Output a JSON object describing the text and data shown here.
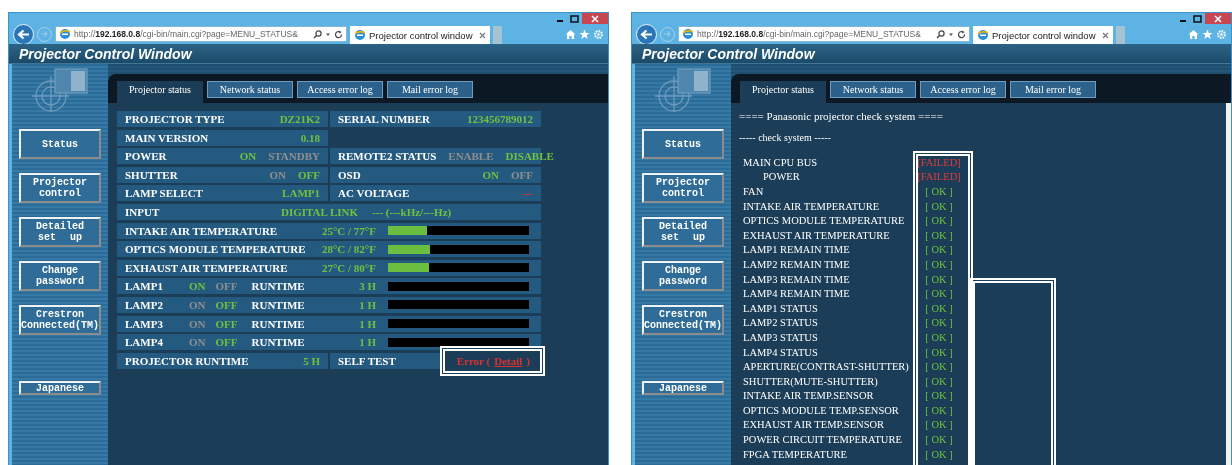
{
  "windows": [
    {
      "address": "http://**192.168.0.8**/cgi-bin/main.cgi?page=MENU_STATUS&",
      "tab_title": "Projector control window",
      "app_title": "Projector Control Window",
      "scrollbar": false,
      "sidebar": {
        "items": [
          "Status",
          "Projector control",
          "Detailed set up",
          "Change password",
          "Crestron Connected(TM)"
        ],
        "language": "Japanese"
      },
      "tabs": [
        {
          "label": "Projector status",
          "selected": true
        },
        {
          "label": "Network status",
          "selected": false
        },
        {
          "label": "Access error log",
          "selected": false
        },
        {
          "label": "Mail error log",
          "selected": false
        }
      ],
      "content": {
        "kind": "status",
        "rows": [
          {
            "kind": "pair",
            "cells": [
              {
                "label": "PROJECTOR TYPE",
                "value": "DZ21K2",
                "alert": false
              },
              {
                "label": "SERIAL NUMBER",
                "value": "123456789012",
                "alert": false
              }
            ]
          },
          {
            "kind": "pair",
            "cells": [
              {
                "label": "MAIN VERSION",
                "value": "0.18",
                "alert": false
              }
            ]
          },
          {
            "kind": "pair",
            "cells": [
              {
                "label": "POWER",
                "options": [
                  {
                    "text": "ON",
                    "on": true
                  },
                  {
                    "text": "STANDBY",
                    "on": false
                  }
                ]
              },
              {
                "label": "REMOTE2 STATUS",
                "options": [
                  {
                    "text": "ENABLE",
                    "on": false
                  },
                  {
                    "text": "DISABLE",
                    "on": true
                  }
                ]
              }
            ]
          },
          {
            "kind": "pair",
            "cells": [
              {
                "label": "SHUTTER",
                "options": [
                  {
                    "text": "ON",
                    "on": false
                  },
                  {
                    "text": "OFF",
                    "on": true
                  }
                ]
              },
              {
                "label": "OSD",
                "options": [
                  {
                    "text": "ON",
                    "on": true
                  },
                  {
                    "text": "OFF",
                    "on": false
                  }
                ]
              }
            ]
          },
          {
            "kind": "pair",
            "cells": [
              {
                "label": "LAMP SELECT",
                "value": "LAMP1",
                "alert": false
              },
              {
                "label": "AC VOLTAGE",
                "value": "---",
                "alert": true
              }
            ]
          },
          {
            "kind": "input",
            "label": "INPUT",
            "value": "DIGITAL LINK",
            "detail": "--- (---kHz/---Hz)"
          },
          {
            "kind": "meter",
            "label": "INTAKE AIR TEMPERATURE",
            "reading": "25°C / 77°F",
            "level": 0.28
          },
          {
            "kind": "meter",
            "label": "OPTICS MODULE TEMPERATURE",
            "reading": "28°C / 82°F",
            "level": 0.3
          },
          {
            "kind": "meter",
            "label": "EXHAUST AIR TEMPERATURE",
            "reading": "27°C / 80°F",
            "level": 0.29
          },
          {
            "kind": "lamp",
            "label": "LAMP1",
            "options": [
              {
                "text": "ON",
                "on": true
              },
              {
                "text": "OFF",
                "on": false
              }
            ],
            "runtime_label": "RUNTIME",
            "runtime": "3 H",
            "level": 0
          },
          {
            "kind": "lamp",
            "label": "LAMP2",
            "options": [
              {
                "text": "ON",
                "on": false
              },
              {
                "text": "OFF",
                "on": true
              }
            ],
            "runtime_label": "RUNTIME",
            "runtime": "1 H",
            "level": 0
          },
          {
            "kind": "lamp",
            "label": "LAMP3",
            "options": [
              {
                "text": "ON",
                "on": false
              },
              {
                "text": "OFF",
                "on": true
              }
            ],
            "runtime_label": "RUNTIME",
            "runtime": "1 H",
            "level": 0
          },
          {
            "kind": "lamp",
            "label": "LAMP4",
            "options": [
              {
                "text": "ON",
                "on": false
              },
              {
                "text": "OFF",
                "on": true
              }
            ],
            "runtime_label": "RUNTIME",
            "runtime": "1 H",
            "level": 0
          },
          {
            "kind": "pair",
            "cells": [
              {
                "label": "PROJECTOR RUNTIME",
                "value": "5 H",
                "alert": false
              },
              {
                "label": "SELF TEST",
                "result": "Error (",
                "link": "Detail",
                "result_end": ")",
                "highlighted": true
              }
            ]
          }
        ]
      }
    },
    {
      "address": "http://**192.168.0.8**/cgi-bin/main.cgi?page=MENU_STATUS&",
      "tab_title": "Projector control window",
      "app_title": "Projector Control Window",
      "scrollbar": true,
      "sidebar": {
        "items": [
          "Status",
          "Projector control",
          "Detailed set up",
          "Change password",
          "Crestron Connected(TM)"
        ],
        "language": "Japanese"
      },
      "tabs": [
        {
          "label": "Projector status",
          "selected": true
        },
        {
          "label": "Network status",
          "selected": false
        },
        {
          "label": "Access error log",
          "selected": false
        },
        {
          "label": "Mail error log",
          "selected": false
        }
      ],
      "content": {
        "kind": "check",
        "heading": "==== Panasonic projector check system ====",
        "subheading": "----- check system -----",
        "highlighted": true,
        "checks": [
          {
            "name": "MAIN CPU BUS",
            "result": "[FAILED]",
            "failed": true,
            "children": [
              {
                "name": "POWER",
                "result": "[FAILED]",
                "failed": true
              }
            ]
          },
          {
            "name": "FAN",
            "result": "[ OK ]",
            "failed": false
          },
          {
            "name": "INTAKE AIR TEMPERATURE",
            "result": "[ OK ]",
            "failed": false
          },
          {
            "name": "OPTICS MODULE TEMPERATURE",
            "result": "[ OK ]",
            "failed": false
          },
          {
            "name": "EXHAUST AIR TEMPERATURE",
            "result": "[ OK ]",
            "failed": false
          },
          {
            "name": "LAMP1 REMAIN TIME",
            "result": "[ OK ]",
            "failed": false
          },
          {
            "name": "LAMP2 REMAIN TIME",
            "result": "[ OK ]",
            "failed": false
          },
          {
            "name": "LAMP3 REMAIN TIME",
            "result": "[ OK ]",
            "failed": false
          },
          {
            "name": "LAMP4 REMAIN TIME",
            "result": "[ OK ]",
            "failed": false
          },
          {
            "name": "LAMP1 STATUS",
            "result": "[ OK ]",
            "failed": false
          },
          {
            "name": "LAMP2 STATUS",
            "result": "[ OK ]",
            "failed": false
          },
          {
            "name": "LAMP3 STATUS",
            "result": "[ OK ]",
            "failed": false
          },
          {
            "name": "LAMP4 STATUS",
            "result": "[ OK ]",
            "failed": false
          },
          {
            "name": "APERTURE(CONTRAST-SHUTTER)",
            "result": "[ OK ]",
            "failed": false
          },
          {
            "name": "SHUTTER(MUTE-SHUTTER)",
            "result": "[ OK ]",
            "failed": false
          },
          {
            "name": "INTAKE AIR TEMP.SENSOR",
            "result": "[ OK ]",
            "failed": false
          },
          {
            "name": "OPTICS MODULE TEMP.SENSOR",
            "result": "[ OK ]",
            "failed": false
          },
          {
            "name": "EXHAUST AIR TEMP.SENSOR",
            "result": "[ OK ]",
            "failed": false
          },
          {
            "name": "POWER CIRCUIT TEMPERATURE",
            "result": "[ OK ]",
            "failed": false
          },
          {
            "name": "FPGA TEMPERATURE",
            "result": "[ OK ]",
            "failed": false
          }
        ]
      }
    }
  ]
}
